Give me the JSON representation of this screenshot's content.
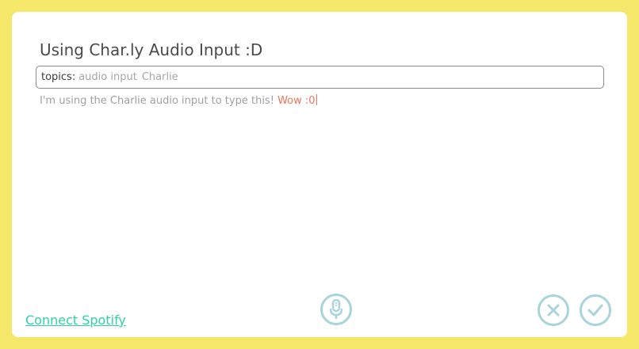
{
  "editor": {
    "title": "Using Char.ly Audio Input :D",
    "topics_label": "topics:",
    "topics": [
      "audio input",
      "Charlie"
    ],
    "note_text": "I'm using the Charlie audio input to type this! ",
    "note_highlight": "Wow :0"
  },
  "footer": {
    "spotify_link": "Connect Spotify",
    "mic_icon": "microphone-icon",
    "cancel_icon": "close-icon",
    "confirm_icon": "check-icon"
  },
  "colors": {
    "background": "#f4e76a",
    "card": "#ffffff",
    "accent_link": "#2ed3a3",
    "highlight": "#f0735a",
    "icon_outline": "#a9d4dc"
  }
}
